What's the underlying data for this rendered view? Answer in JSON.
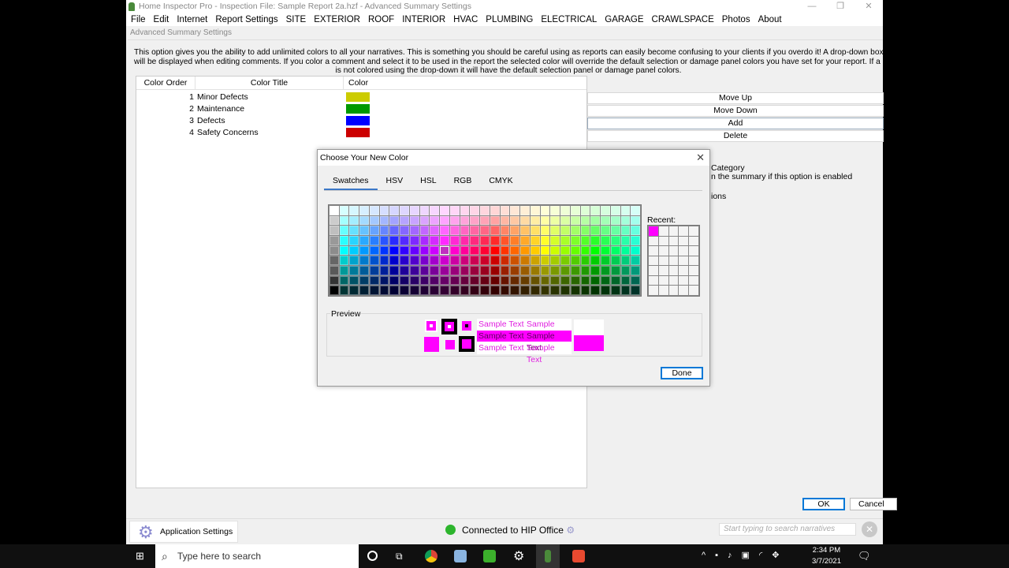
{
  "window": {
    "title": "Home Inspector Pro - Inspection File: Sample Report 2a.hzf - Advanced Summary Settings",
    "subtitle": "Advanced Summary Settings",
    "controls": [
      "—",
      "❐",
      "✕"
    ]
  },
  "menu": [
    "File",
    "Edit",
    "Internet",
    "Report Settings",
    "SITE",
    "EXTERIOR",
    "ROOF",
    "INTERIOR",
    "HVAC",
    "PLUMBING",
    "ELECTRICAL",
    "GARAGE",
    "CRAWLSPACE",
    "Photos",
    "About"
  ],
  "description": [
    "This option gives you the ability to add unlimited colors to all your narratives. This is something you should be careful using as reports can easily become confusing to your clients if you overdo it! A drop-down box of colors",
    "will be displayed when editing comments. If you color a comment and select it to be used in the report the selected color will override the default selection or damage panel colors you have set for your report. If a comment",
    "is not colored using the drop-down it will have the default selection panel or damage panel colors."
  ],
  "table": {
    "headers": [
      "Color Order",
      "Color Title",
      "Color"
    ],
    "rows": [
      {
        "order": "1",
        "title": "Minor Defects",
        "color": "#cccc00"
      },
      {
        "order": "2",
        "title": "Maintenance",
        "color": "#009900"
      },
      {
        "order": "3",
        "title": "Defects",
        "color": "#0000ff"
      },
      {
        "order": "4",
        "title": "Safety Concerns",
        "color": "#cc0000"
      }
    ]
  },
  "side_buttons": [
    "Move Up",
    "Move Down",
    "Add",
    "Delete"
  ],
  "background_text": [
    "Category",
    "n the summary if this option is enabled",
    "ions"
  ],
  "ok_label": "OK",
  "cancel_label": "Cancel",
  "dialog": {
    "title": "Choose Your New Color",
    "tabs": [
      "Swatches",
      "HSV",
      "HSL",
      "RGB",
      "CMYK"
    ],
    "active_tab": "Swatches",
    "recent_label": "Recent:",
    "recent_colors": [
      "#ff00ff"
    ],
    "selected_color": "#ff00ff",
    "preview_label": "Preview",
    "sample_text": "Sample Text",
    "done_label": "Done"
  },
  "status": {
    "app_settings": "Application Settings",
    "connection": "Connected to HIP Office",
    "search_placeholder": "Start typing to search narratives"
  },
  "taskbar": {
    "search_placeholder": "Type here to search",
    "time": "2:34 PM",
    "date": "3/7/2021"
  }
}
